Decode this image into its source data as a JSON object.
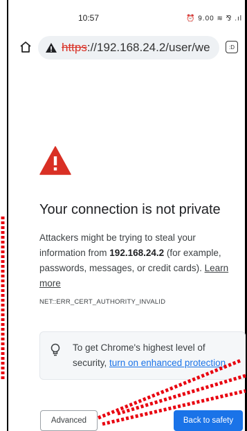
{
  "status_bar": {
    "time": "10:57",
    "icons": "⏰ 9.00 ≋ ⅋ .ıl"
  },
  "omnibox": {
    "scheme": "https",
    "rest": "://192.168.24.2/user/we",
    "tab_count": ":D"
  },
  "interstitial": {
    "title": "Your connection is not private",
    "body_prefix": "Attackers might be trying to steal your information from ",
    "host": "192.168.24.2",
    "body_suffix": " (for example, passwords, messages, or credit cards). ",
    "learn_more": "Learn more",
    "error_code": "NET::ERR_CERT_AUTHORITY_INVALID",
    "promo_prefix": "To get Chrome's highest level of security, ",
    "promo_link": "turn on enhanced protection",
    "advanced_button": "Advanced",
    "back_button": "Back to safety"
  },
  "colors": {
    "warning_red": "#d93025",
    "link_blue": "#1a73e8",
    "annotation_red": "#e8000f"
  }
}
